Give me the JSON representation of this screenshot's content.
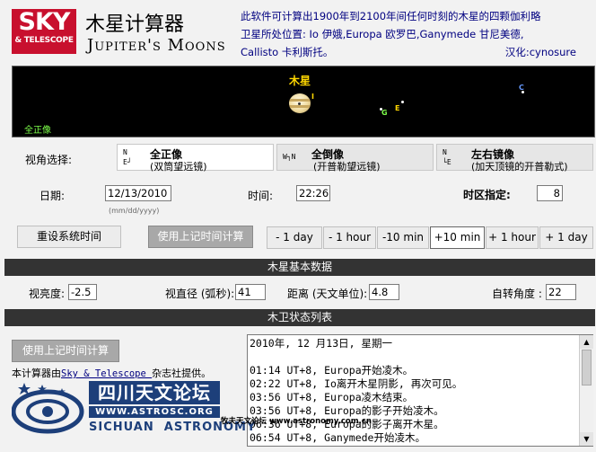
{
  "header": {
    "logo_big": "SKY",
    "logo_small": "& TELESCOPE",
    "title_cn": "木星计算器",
    "title_en": "Jupiter's Moons",
    "desc_line1": "此软件可计算出1900年到2100年间任何时刻的木星的四颗伽利略",
    "desc_line2": "卫星所处位置: Io 伊娥,Europa 欧罗巴,Ganymede 甘尼美德,",
    "desc_line3": "Callisto 卡利斯托。",
    "credit": "汉化:cynosure"
  },
  "sky": {
    "planet_label": "木星",
    "view_label": "全正像",
    "moon_labels": [
      "I",
      "G",
      "E",
      "C"
    ]
  },
  "view": {
    "label": "视角选择:",
    "options": [
      {
        "icon": "N\nE┘",
        "title": "全正像",
        "sub": "(双筒望远镜)"
      },
      {
        "icon": "W┐N",
        "title": "全倒像",
        "sub": "(开普勒望远镜)"
      },
      {
        "icon": "N\n└E",
        "title": "左右镜像",
        "sub": "(加天顶镜的开普勒式)"
      }
    ]
  },
  "datetime": {
    "date_label": "日期:",
    "date_value": "12/13/2010",
    "date_hint": "(mm/dd/yyyy)",
    "time_label": "时间:",
    "time_value": "22:26",
    "tz_label": "时区指定:",
    "tz_value": "8"
  },
  "actions": {
    "reset": "重设系统时间",
    "compute": "使用上记时间计算",
    "steps": [
      "- 1 day",
      "- 1 hour",
      "-10 min",
      "+10 min",
      "+ 1 hour",
      "+ 1 day"
    ]
  },
  "jupiter_data": {
    "section_title": "木星基本数据",
    "brightness_label": "视亮度:",
    "brightness_value": "-2.5",
    "diameter_label": "视直径 (弧秒):",
    "diameter_value": "41",
    "distance_label": "距离 (天文单位):",
    "distance_value": "4.8",
    "rotation_label": "自转角度 :",
    "rotation_value": "22"
  },
  "moons_section": {
    "section_title": "木卫状态列表",
    "compute_button": "使用上记时间计算",
    "credit_pre": "本计算器由",
    "credit_link": "Sky & Telescope ",
    "credit_post": "杂志社提供。",
    "log_lines": [
      "2010年, 12 月13日, 星期一",
      "",
      "01:14 UT+8, Europa开始凌木。",
      "02:22 UT+8, Io离开木星阴影, 再次可见。",
      "03:56 UT+8, Europa凌木结束。",
      "03:56 UT+8, Europa的影子开始凌木。",
      "06:36 UT+8, Europa的影子离开木星。",
      "06:54 UT+8, Ganymede开始凌木。"
    ]
  },
  "bottom": {
    "logo_cn": "四川天文论坛",
    "logo_url": "WWW.ASTROSC.ORG",
    "logo_en": "SICHUAN  ASTRONOMY",
    "footer": "牧夫天文论坛 www.astronomy.com.cn"
  }
}
